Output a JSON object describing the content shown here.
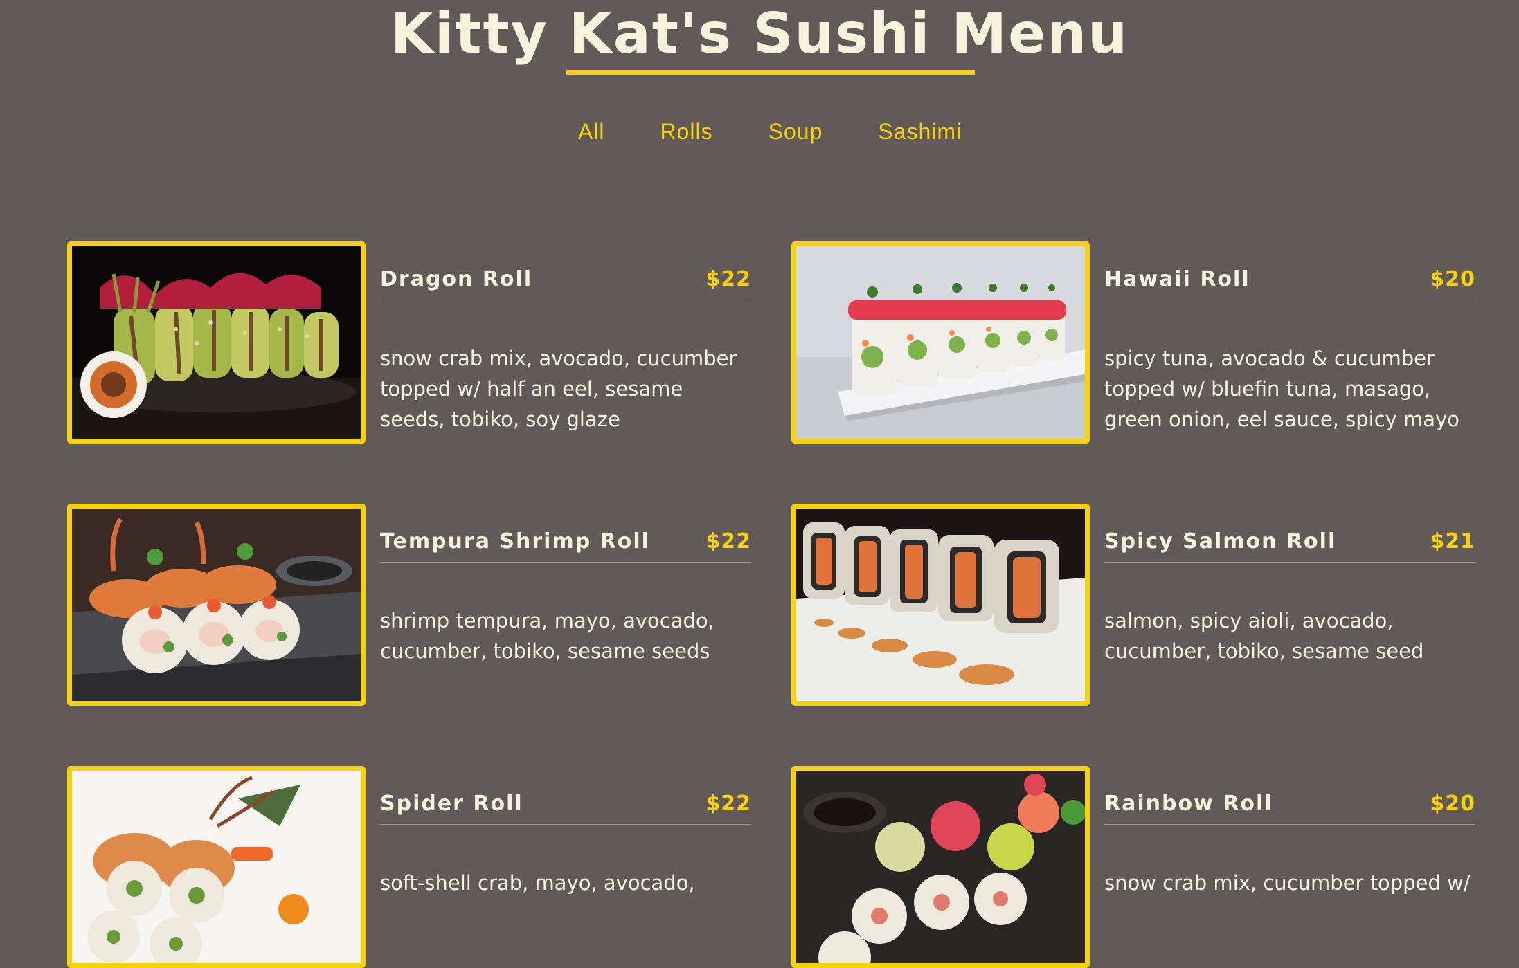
{
  "header": {
    "title": "Kitty Kat's Sushi Menu"
  },
  "filters": [
    "All",
    "Rolls",
    "Soup",
    "Sashimi"
  ],
  "menu": {
    "items": [
      {
        "name": "Dragon Roll",
        "price": "$22",
        "desc": "snow crab mix, avocado, cucumber topped w/ half an eel, sesame seeds, tobiko, soy glaze",
        "image": "dragon-roll-photo"
      },
      {
        "name": "Hawaii Roll",
        "price": "$20",
        "desc": "spicy tuna, avocado & cucumber topped w/ bluefin tuna, masago, green onion, eel sauce, spicy mayo",
        "image": "hawaii-roll-photo"
      },
      {
        "name": "Tempura Shrimp Roll",
        "price": "$22",
        "desc": "shrimp tempura, mayo, avocado, cucumber, tobiko, sesame seeds",
        "image": "tempura-shrimp-roll-photo"
      },
      {
        "name": "Spicy Salmon Roll",
        "price": "$21",
        "desc": "salmon, spicy aioli, avocado, cucumber, tobiko, sesame seed",
        "image": "spicy-salmon-roll-photo"
      },
      {
        "name": "Spider Roll",
        "price": "$22",
        "desc": "soft-shell crab, mayo, avocado,",
        "image": "spider-roll-photo"
      },
      {
        "name": "Rainbow Roll",
        "price": "$20",
        "desc": "snow crab mix, cucumber topped w/",
        "image": "rainbow-roll-photo"
      }
    ]
  },
  "colors": {
    "background": "#615a59",
    "accent": "#f7d20b",
    "text": "#f7f2dc"
  }
}
